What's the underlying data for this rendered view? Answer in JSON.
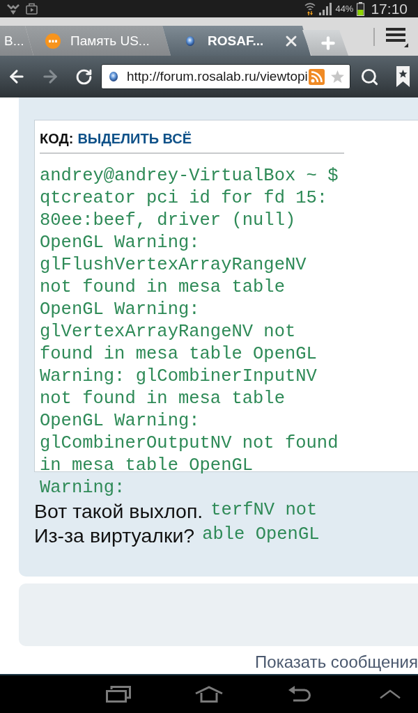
{
  "status_bar": {
    "battery": "44%",
    "time": "17:10"
  },
  "tabs": [
    {
      "label": "В...",
      "selected": false,
      "kind": "plain"
    },
    {
      "label": "Память US...",
      "selected": false,
      "kind": "logo"
    },
    {
      "label": "ROSAF...",
      "selected": true,
      "kind": "sphere"
    }
  ],
  "toolbar": {
    "nav_buttons": [
      {
        "kind": "back",
        "disabled": false
      },
      {
        "kind": "forward",
        "disabled": true
      },
      {
        "kind": "reload",
        "disabled": false
      }
    ],
    "url": "http://forum.rosalab.ru/viewtopi"
  },
  "post": {
    "code": {
      "label": "КОД:",
      "action": "ВЫДЕЛИТЬ ВСЁ",
      "lines": [
        "andrey@andrey-VirtualBox ~ $",
        "qtcreator pci id for fd 15:",
        "80ee:beef, driver (null)",
        "OpenGL Warning:",
        "glFlushVertexArrayRangeNV",
        "not found in mesa table",
        "OpenGL Warning:",
        "glVertexArrayRangeNV not",
        "found in mesa table OpenGL",
        "Warning: glCombinerInputNV",
        "not found in mesa table",
        "OpenGL Warning:",
        "glCombinerOutputNV not found",
        "in mesa table OpenGL",
        "Warning:"
      ]
    },
    "rows": [
      {
        "text": "Вот такой выхлоп.",
        "code_fragment": "terfNV not"
      },
      {
        "text": "Из-за виртуалки?",
        "code_fragment": "able OpenGL"
      }
    ]
  },
  "show_messages_link": "Показать сообщения"
}
